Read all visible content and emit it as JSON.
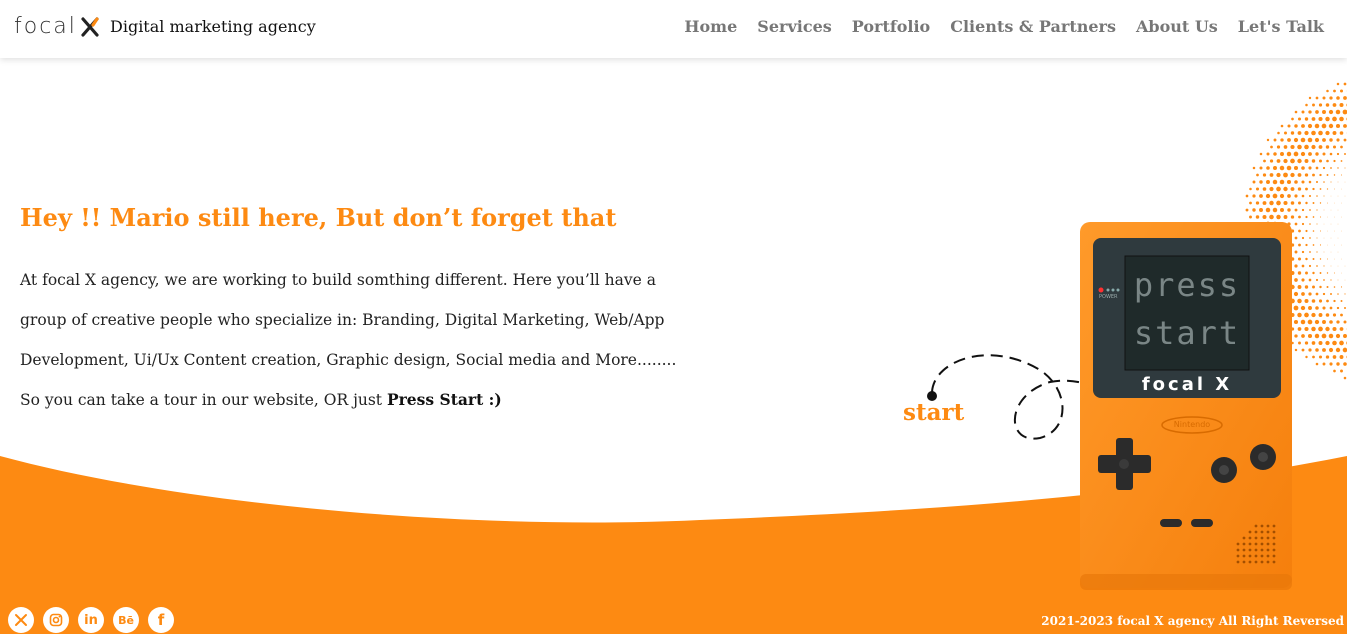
{
  "header": {
    "logo_text": "focal",
    "logo_mark": "X",
    "tagline": "Digital marketing agency",
    "nav": [
      "Home",
      "Services",
      "Portfolio",
      "Clients & Partners",
      "About Us",
      "Let's Talk"
    ]
  },
  "hero": {
    "title": "Hey !! Mario still here, But don’t forget that",
    "body": "At focal X agency, we are working to build somthing different. Here you’ll have a group of creative people who specialize in: Branding, Digital Marketing, Web/App Development, Ui/Ux Content creation, Graphic design, Social media and More........ So you can take a tour in our website, OR just",
    "cta": "Press Start :)"
  },
  "gameboy": {
    "screen_line1": "press",
    "screen_line2": "start",
    "brand": "focal X",
    "power_label": "POWER",
    "nintendo_label": "Nintendo"
  },
  "start_label": "start",
  "footer": {
    "socials": [
      "x-icon",
      "instagram-icon",
      "linkedin-icon",
      "behance-icon",
      "facebook-icon"
    ],
    "copyright": "2021-2023 focal X agency All Right Reversed"
  },
  "colors": {
    "accent": "#fd8a12",
    "screen": "#2f3a3e",
    "device": "#ff8c1a"
  }
}
